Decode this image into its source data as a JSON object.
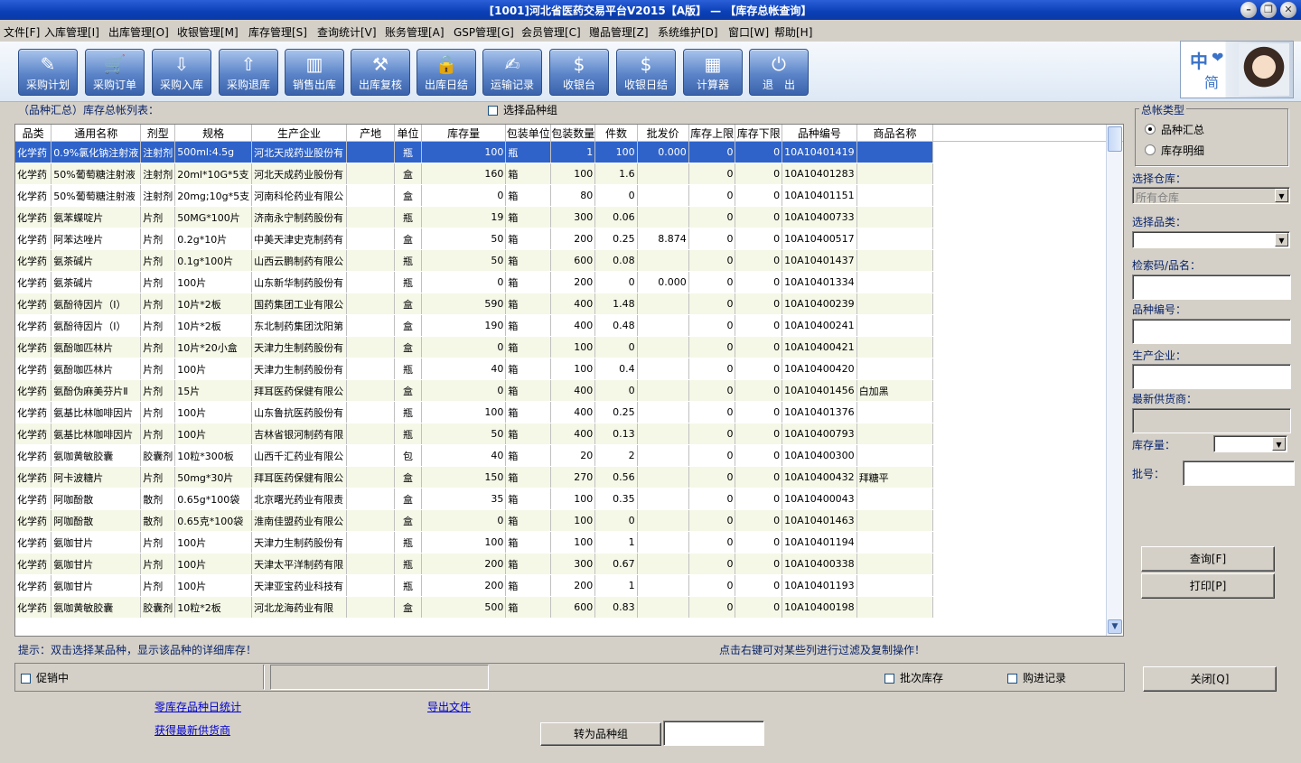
{
  "window": {
    "title": "[1001]河北省医药交易平台V2015【A版】 — 【库存总帐查询】"
  },
  "menu": [
    "文件[F]",
    "入库管理[I]",
    "出库管理[O]",
    "收银管理[M]",
    "库存管理[S]",
    "查询统计[V]",
    "账务管理[A]",
    "GSP管理[G]",
    "会员管理[C]",
    "赠品管理[Z]",
    "系统维护[D]",
    "窗口[W]",
    "帮助[H]"
  ],
  "toolbar": [
    {
      "label": "采购计划",
      "icon": "plan-icon",
      "glyph": "✎"
    },
    {
      "label": "采购订单",
      "icon": "cart-icon",
      "glyph": "🛒"
    },
    {
      "label": "采购入库",
      "icon": "download-icon",
      "glyph": "⇩"
    },
    {
      "label": "采购退库",
      "icon": "upload-icon",
      "glyph": "⇧"
    },
    {
      "label": "销售出库",
      "icon": "chart-icon",
      "glyph": "▥"
    },
    {
      "label": "出库复核",
      "icon": "gavel-icon",
      "glyph": "⚒"
    },
    {
      "label": "出库日结",
      "icon": "lock-icon",
      "glyph": "🔒"
    },
    {
      "label": "运输记录",
      "icon": "edit-icon",
      "glyph": "✍"
    },
    {
      "label": "收银台",
      "icon": "register-icon",
      "glyph": "$"
    },
    {
      "label": "收银日结",
      "icon": "moneybag-icon",
      "glyph": "$"
    },
    {
      "label": "计算器",
      "icon": "calculator-icon",
      "glyph": "▦"
    },
    {
      "label": "退　出",
      "icon": "power-icon",
      "glyph": "⏻"
    }
  ],
  "avatar": {
    "zh": "中",
    "jian": "简"
  },
  "list_title": "（品种汇总）库存总帐列表：",
  "select_group_label": "选择品种组",
  "columns": [
    "品类",
    "通用名称",
    "剂型",
    "规格",
    "生产企业",
    "产地",
    "单位",
    "库存量",
    "包装单位",
    "包装数量",
    "件数",
    "批发价",
    "库存上限",
    "库存下限",
    "品种编号",
    "商品名称"
  ],
  "rows": [
    [
      "化学药",
      "0.9%氯化钠注射液",
      "注射剂",
      "500ml:4.5g",
      "河北天成药业股份有",
      "",
      "瓶",
      "100",
      "瓶",
      "1",
      "100",
      "0.000",
      "0",
      "0",
      "10A10401419",
      ""
    ],
    [
      "化学药",
      "50%葡萄糖注射液",
      "注射剂",
      "20ml*10G*5支",
      "河北天成药业股份有",
      "",
      "盒",
      "160",
      "箱",
      "100",
      "1.6",
      "",
      "0",
      "0",
      "10A10401283",
      ""
    ],
    [
      "化学药",
      "50%葡萄糖注射液",
      "注射剂",
      "20mg;10g*5支",
      "河南科伦药业有限公",
      "",
      "盒",
      "0",
      "箱",
      "80",
      "0",
      "",
      "0",
      "0",
      "10A10401151",
      ""
    ],
    [
      "化学药",
      "氨苯蝶啶片",
      "片剂",
      "50MG*100片",
      "济南永宁制药股份有",
      "",
      "瓶",
      "19",
      "箱",
      "300",
      "0.06",
      "",
      "0",
      "0",
      "10A10400733",
      ""
    ],
    [
      "化学药",
      "阿苯达唑片",
      "片剂",
      "0.2g*10片",
      "中美天津史克制药有",
      "",
      "盒",
      "50",
      "箱",
      "200",
      "0.25",
      "8.874",
      "0",
      "0",
      "10A10400517",
      ""
    ],
    [
      "化学药",
      "氨茶碱片",
      "片剂",
      "0.1g*100片",
      "山西云鹏制药有限公",
      "",
      "瓶",
      "50",
      "箱",
      "600",
      "0.08",
      "",
      "0",
      "0",
      "10A10401437",
      ""
    ],
    [
      "化学药",
      "氨茶碱片",
      "片剂",
      "100片",
      "山东新华制药股份有",
      "",
      "瓶",
      "0",
      "箱",
      "200",
      "0",
      "0.000",
      "0",
      "0",
      "10A10401334",
      ""
    ],
    [
      "化学药",
      "氨酚待因片（Ⅰ）",
      "片剂",
      "10片*2板",
      "国药集团工业有限公",
      "",
      "盒",
      "590",
      "箱",
      "400",
      "1.48",
      "",
      "0",
      "0",
      "10A10400239",
      ""
    ],
    [
      "化学药",
      "氨酚待因片（Ⅰ）",
      "片剂",
      "10片*2板",
      "东北制药集团沈阳第",
      "",
      "盒",
      "190",
      "箱",
      "400",
      "0.48",
      "",
      "0",
      "0",
      "10A10400241",
      ""
    ],
    [
      "化学药",
      "氨酚咖匹林片",
      "片剂",
      "10片*20小盒",
      "天津力生制药股份有",
      "",
      "盒",
      "0",
      "箱",
      "100",
      "0",
      "",
      "0",
      "0",
      "10A10400421",
      ""
    ],
    [
      "化学药",
      "氨酚咖匹林片",
      "片剂",
      "100片",
      "天津力生制药股份有",
      "",
      "瓶",
      "40",
      "箱",
      "100",
      "0.4",
      "",
      "0",
      "0",
      "10A10400420",
      ""
    ],
    [
      "化学药",
      "氨酚伪麻美芬片Ⅱ",
      "片剂",
      "15片",
      "拜耳医药保健有限公",
      "",
      "盒",
      "0",
      "箱",
      "400",
      "0",
      "",
      "0",
      "0",
      "10A10401456",
      "白加黑"
    ],
    [
      "化学药",
      "氨基比林咖啡因片",
      "片剂",
      "100片",
      "山东鲁抗医药股份有",
      "",
      "瓶",
      "100",
      "箱",
      "400",
      "0.25",
      "",
      "0",
      "0",
      "10A10401376",
      ""
    ],
    [
      "化学药",
      "氨基比林咖啡因片",
      "片剂",
      "100片",
      "吉林省银河制药有限",
      "",
      "瓶",
      "50",
      "箱",
      "400",
      "0.13",
      "",
      "0",
      "0",
      "10A10400793",
      ""
    ],
    [
      "化学药",
      "氨咖黄敏胶囊",
      "胶囊剂",
      "10粒*300板",
      "山西千汇药业有限公",
      "",
      "包",
      "40",
      "箱",
      "20",
      "2",
      "",
      "0",
      "0",
      "10A10400300",
      ""
    ],
    [
      "化学药",
      "阿卡波糖片",
      "片剂",
      "50mg*30片",
      "拜耳医药保健有限公",
      "",
      "盒",
      "150",
      "箱",
      "270",
      "0.56",
      "",
      "0",
      "0",
      "10A10400432",
      "拜糖平"
    ],
    [
      "化学药",
      "阿咖酚散",
      "散剂",
      "0.65g*100袋",
      "北京曙光药业有限责",
      "",
      "盒",
      "35",
      "箱",
      "100",
      "0.35",
      "",
      "0",
      "0",
      "10A10400043",
      ""
    ],
    [
      "化学药",
      "阿咖酚散",
      "散剂",
      "0.65克*100袋",
      "淮南佳盟药业有限公",
      "",
      "盒",
      "0",
      "箱",
      "100",
      "0",
      "",
      "0",
      "0",
      "10A10401463",
      ""
    ],
    [
      "化学药",
      "氨咖甘片",
      "片剂",
      "100片",
      "天津力生制药股份有",
      "",
      "瓶",
      "100",
      "箱",
      "100",
      "1",
      "",
      "0",
      "0",
      "10A10401194",
      ""
    ],
    [
      "化学药",
      "氨咖甘片",
      "片剂",
      "100片",
      "天津太平洋制药有限",
      "",
      "瓶",
      "200",
      "箱",
      "300",
      "0.67",
      "",
      "0",
      "0",
      "10A10400338",
      ""
    ],
    [
      "化学药",
      "氨咖甘片",
      "片剂",
      "100片",
      "天津亚宝药业科技有",
      "",
      "瓶",
      "200",
      "箱",
      "200",
      "1",
      "",
      "0",
      "0",
      "10A10401193",
      ""
    ],
    [
      "化学药",
      "氨咖黄敏胶囊",
      "胶囊剂",
      "10粒*2板",
      "河北龙海药业有限",
      "",
      "盒",
      "500",
      "箱",
      "600",
      "0.83",
      "",
      "0",
      "0",
      "10A10400198",
      ""
    ]
  ],
  "hint_left": "提示：双击选择某品种，显示该品种的详细库存！",
  "hint_right": "点击右键可对某些列进行过滤及复制操作！",
  "promo_label": "促销中",
  "batch_label": "批次库存",
  "purchase_label": "购进记录",
  "links": {
    "zero_stock": "零库存品种日统计",
    "export": "导出文件",
    "latest_supplier": "获得最新供货商"
  },
  "to_group_button": "转为品种组",
  "right_panel": {
    "group_title": "总帐类型",
    "radio_summary": "品种汇总",
    "radio_detail": "库存明细",
    "warehouse_label": "选择仓库：",
    "warehouse_value": "所有仓库",
    "category_label": "选择品类：",
    "search_label": "检索码/品名：",
    "code_label": "品种编号：",
    "maker_label": "生产企业：",
    "supplier_label": "最新供货商：",
    "stock_label": "库存量：",
    "batch_label": "批号：",
    "query_button": "查询[F]",
    "print_button": "打印[P]",
    "close_button": "关闭[Q]"
  }
}
